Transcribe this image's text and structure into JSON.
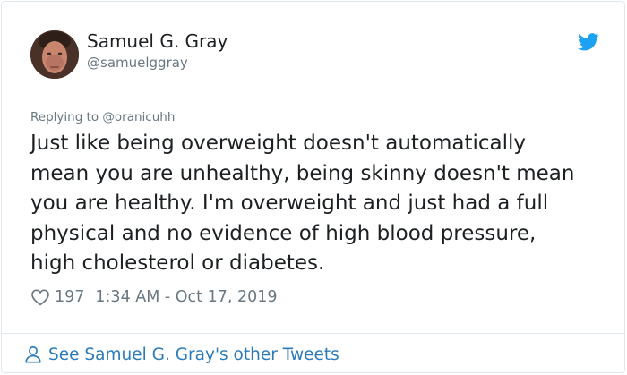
{
  "author": {
    "display_name": "Samuel G. Gray",
    "handle": "@samuelggray",
    "avatar_icon": "profile-photo"
  },
  "reply_context": "Replying to @oranicuhh",
  "tweet": {
    "text": "Just like being overweight doesn't automatically\nmean you are unhealthy, being skinny doesn't mean\nyou are healthy.  I'm overweight and just had a full\nphysical and no evidence of high blood pressure,\nhigh cholesterol or diabetes.",
    "like_count": "197",
    "timestamp": "1:34 AM - Oct 17, 2019"
  },
  "footer": {
    "see_more_label": "See Samuel G. Gray's other Tweets"
  },
  "icons": {
    "brand": "twitter-bird-icon",
    "like": "heart-icon",
    "profile": "person-icon"
  },
  "colors": {
    "brand_blue": "#1da1f2",
    "link_blue": "#2b7bb9",
    "muted_text": "#697882",
    "body_text": "#1c2022",
    "border": "#e1e8ed"
  }
}
